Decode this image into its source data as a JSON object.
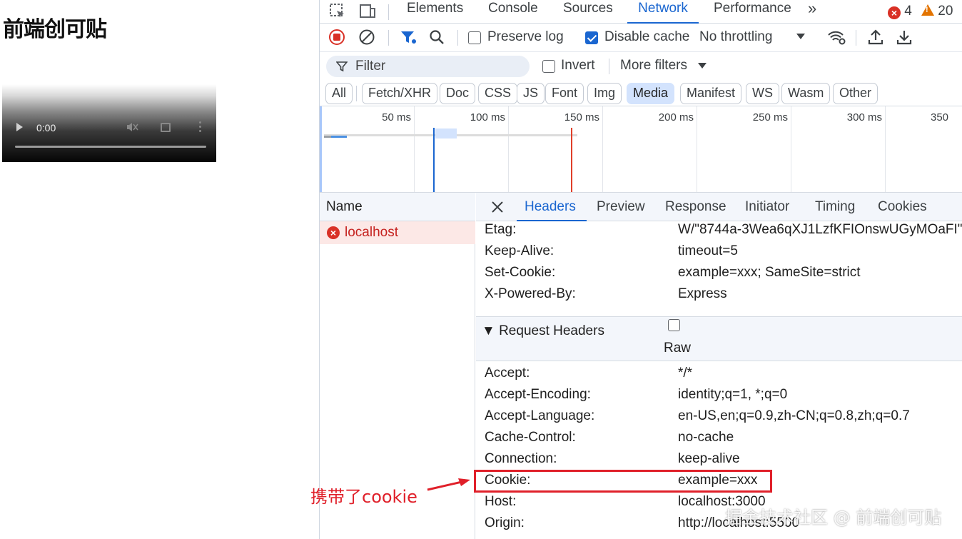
{
  "page": {
    "heading": "前端创可贴",
    "video": {
      "time": "0:00"
    }
  },
  "devtools": {
    "tabs": [
      "Elements",
      "Console",
      "Sources",
      "Network",
      "Performance"
    ],
    "active_tab": "Network",
    "more_tabs": "»",
    "errors_count": "4",
    "warnings_count": "20",
    "controls": {
      "preserve_log": "Preserve log",
      "preserve_log_checked": false,
      "disable_cache": "Disable cache",
      "disable_cache_checked": true,
      "throttling": "No throttling"
    },
    "filter": {
      "placeholder": "Filter",
      "invert": "Invert",
      "more_filters": "More filters"
    },
    "types": [
      "All",
      "Fetch/XHR",
      "Doc",
      "CSS",
      "JS",
      "Font",
      "Img",
      "Media",
      "Manifest",
      "WS",
      "Wasm",
      "Other"
    ],
    "active_type": "Media",
    "timeline_labels": [
      "50 ms",
      "100 ms",
      "150 ms",
      "200 ms",
      "250 ms",
      "300 ms",
      "350"
    ],
    "name_header": "Name",
    "request": {
      "name": "localhost",
      "status": "error"
    },
    "detail_tabs": [
      "Headers",
      "Preview",
      "Response",
      "Initiator",
      "Timing",
      "Cookies"
    ],
    "active_detail_tab": "Headers",
    "response_headers": [
      {
        "k": "Etag:",
        "v": "W/\"8744a-3Wea6qXJ1LzfKFIOnswUGyMOaFI\""
      },
      {
        "k": "Keep-Alive:",
        "v": "timeout=5"
      },
      {
        "k": "Set-Cookie:",
        "v": "example=xxx; SameSite=strict"
      },
      {
        "k": "X-Powered-By:",
        "v": "Express"
      }
    ],
    "request_section": {
      "title": "▼ Request Headers",
      "raw_label": "Raw"
    },
    "request_headers": [
      {
        "k": "Accept:",
        "v": "*/*"
      },
      {
        "k": "Accept-Encoding:",
        "v": "identity;q=1, *;q=0"
      },
      {
        "k": "Accept-Language:",
        "v": "en-US,en;q=0.9,zh-CN;q=0.8,zh;q=0.7"
      },
      {
        "k": "Cache-Control:",
        "v": "no-cache"
      },
      {
        "k": "Connection:",
        "v": "keep-alive"
      },
      {
        "k": "Cookie:",
        "v": "example=xxx"
      },
      {
        "k": "Host:",
        "v": "localhost:3000"
      },
      {
        "k": "Origin:",
        "v": "http://localhost:5500"
      }
    ]
  },
  "annotation": {
    "text": "携带了cookie",
    "color": "#e0202a"
  },
  "watermark": "掘金技术社区 @ 前端创可贴",
  "colors": {
    "accent": "#1a66d0",
    "error": "#d93025",
    "active_chip": "#d3e3fd"
  }
}
